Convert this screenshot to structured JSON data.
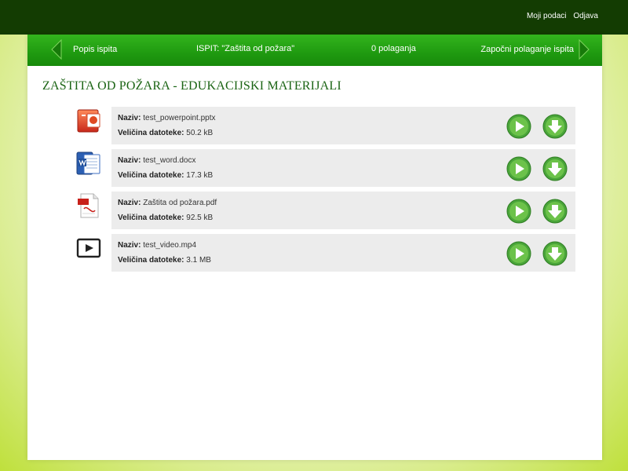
{
  "top_links": {
    "profile": "Moji podaci",
    "logout": "Odjava"
  },
  "nav": {
    "back_label": "Popis ispita",
    "exam_label": "ISPIT: \"Zaštita od požara\"",
    "attempts_label": "0 polaganja",
    "start_label": "Započni polaganje ispita"
  },
  "page_title": "ZAŠTITA OD POŽARA - EDUKACIJSKI MATERIJALI",
  "labels": {
    "name": "Naziv:",
    "size": "Veličina datoteke:"
  },
  "files": [
    {
      "name": "test_powerpoint.pptx",
      "size": "50.2 kB",
      "icon": "powerpoint-icon"
    },
    {
      "name": "test_word.docx",
      "size": "17.3 kB",
      "icon": "word-icon"
    },
    {
      "name": "Zaštita od požara.pdf",
      "size": "92.5 kB",
      "icon": "pdf-icon"
    },
    {
      "name": "test_video.mp4",
      "size": "3.1 MB",
      "icon": "video-icon"
    }
  ],
  "colors": {
    "topbar": "#133c02",
    "navbar": "#1f9a10",
    "title": "#1b6414",
    "card": "#ececec"
  }
}
